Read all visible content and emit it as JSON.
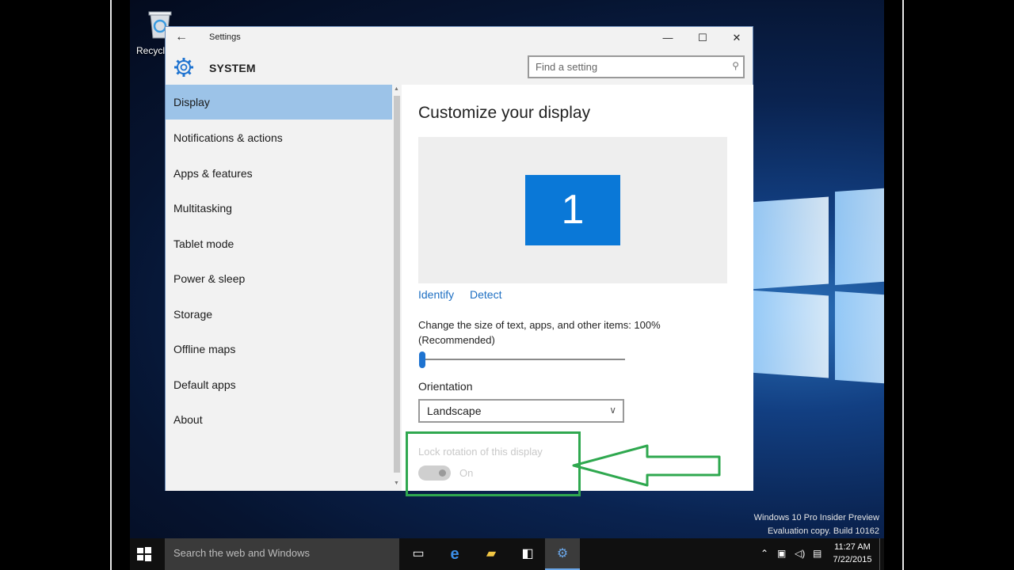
{
  "desktop": {
    "recycle_label": "Recycle",
    "watermark_line1": "Windows 10 Pro Insider Preview",
    "watermark_line2": "Evaluation copy. Build 10162"
  },
  "window": {
    "title": "Settings",
    "back_icon": "←",
    "min_icon": "—",
    "max_icon": "☐",
    "close_icon": "✕",
    "section": "SYSTEM",
    "search_placeholder": "Find a setting",
    "search_icon": "⚲"
  },
  "nav": {
    "items": [
      {
        "label": "Display",
        "active": true
      },
      {
        "label": "Notifications & actions"
      },
      {
        "label": "Apps & features"
      },
      {
        "label": "Multitasking"
      },
      {
        "label": "Tablet mode"
      },
      {
        "label": "Power & sleep"
      },
      {
        "label": "Storage"
      },
      {
        "label": "Offline maps"
      },
      {
        "label": "Default apps"
      },
      {
        "label": "About"
      }
    ]
  },
  "main": {
    "heading": "Customize your display",
    "monitor_number": "1",
    "identify_link": "Identify",
    "detect_link": "Detect",
    "scale_label": "Change the size of text, apps, and other items: 100% (Recommended)",
    "scale_value_percent": 100,
    "orientation_label": "Orientation",
    "orientation_value": "Landscape",
    "orientation_chevron": "∨",
    "lock_label": "Lock rotation of this display",
    "lock_state": "On"
  },
  "colors": {
    "accent": "#0a78d7",
    "nav_active": "#9cc3e8",
    "highlight": "#2fa84f"
  },
  "taskbar": {
    "search_text": "Search the web and Windows",
    "time": "11:27 AM",
    "date": "7/22/2015",
    "icons": [
      "task-view-icon",
      "edge-icon",
      "file-explorer-icon",
      "store-icon",
      "settings-icon"
    ]
  }
}
